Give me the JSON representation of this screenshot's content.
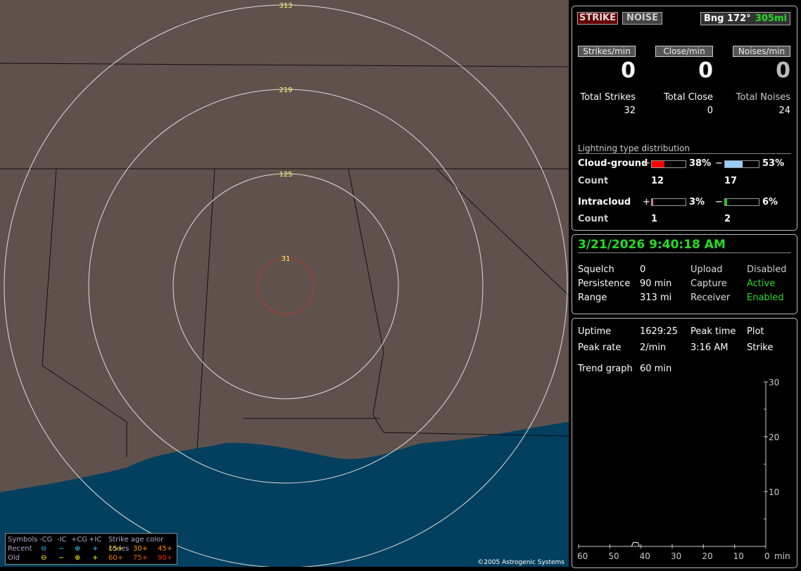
{
  "map": {
    "range_rings": [
      "313",
      "219",
      "125",
      "31"
    ],
    "copyright": "©2005 Astrogenic Systems",
    "colors": {
      "land": "#5f524d",
      "water": "#03405f",
      "ring": "#dddddd",
      "close_ring": "#ff2020",
      "ring_label": "#ffff66"
    }
  },
  "legend": {
    "title": "Symbols",
    "cols": [
      "-CG",
      "-IC",
      "+CG",
      "+IC"
    ],
    "age_title": "Strike age color codes",
    "rows": [
      {
        "label": "Recent",
        "symbols": [
          "⊖",
          "−",
          "⊕",
          "+"
        ],
        "ages": [
          "15+",
          "30+",
          "45+"
        ]
      },
      {
        "label": "Old",
        "symbols": [
          "⊖",
          "−",
          "⊕",
          "+"
        ],
        "ages": [
          "60+",
          "75+",
          "90+"
        ]
      }
    ]
  },
  "top": {
    "strike_button": "STRIKE",
    "noise_button": "NOISE",
    "bearing": "Bng 172°",
    "distance": "305mi",
    "stats": [
      {
        "header": "Strikes/min",
        "value": "0",
        "total_label": "Total Strikes",
        "total": "32"
      },
      {
        "header": "Close/min",
        "value": "0",
        "total_label": "Total Close",
        "total": "0"
      },
      {
        "header": "Noises/min",
        "value": "0",
        "total_label": "Total Noises",
        "total": "24"
      }
    ],
    "distribution": {
      "title": "Lightning type distribution",
      "cg": {
        "label": "Cloud-ground",
        "pos_sign": "+",
        "pos_pct": "38%",
        "pos_value": 38,
        "neg_sign": "−",
        "neg_pct": "53%",
        "neg_value": 53,
        "count_label": "Count",
        "pos_count": "12",
        "neg_count": "17",
        "pos_color": "#ff0000",
        "neg_color": "#99ccff"
      },
      "ic": {
        "label": "Intracloud",
        "pos_sign": "+",
        "pos_pct": "3%",
        "pos_value": 3,
        "neg_sign": "−",
        "neg_pct": "6%",
        "neg_value": 6,
        "count_label": "Count",
        "pos_count": "1",
        "neg_count": "2",
        "pos_color": "#ff66aa",
        "neg_color": "#00dd00"
      }
    }
  },
  "status": {
    "datetime": "3/21/2026 9:40:18 AM",
    "rows": [
      [
        "Squelch",
        "0",
        "Upload",
        "Disabled"
      ],
      [
        "Persistence",
        "90 min",
        "Capture",
        "Active"
      ],
      [
        "Range",
        "313 mi",
        "Receiver",
        "Enabled"
      ]
    ]
  },
  "trend": {
    "uptime_label": "Uptime",
    "uptime": "1629:25",
    "peak_time_label": "Peak time",
    "peak_time": "3:16 AM",
    "plot_label": "Plot",
    "peak_rate_label": "Peak rate",
    "peak_rate": "2/min",
    "plot": "Strike",
    "trend_label": "Trend graph",
    "trend_value": "60 min",
    "chart_data": {
      "type": "line",
      "x_ticks": [
        "60",
        "50",
        "40",
        "30",
        "20",
        "10",
        "0"
      ],
      "x_unit": "min",
      "y_ticks": [
        "30",
        "20",
        "10"
      ],
      "ylim": [
        0,
        30
      ],
      "xlim": [
        60,
        0
      ],
      "x": [
        43,
        42.5,
        42,
        41.5,
        41,
        40.5
      ],
      "y": [
        0,
        1,
        1,
        1,
        1,
        0
      ]
    }
  }
}
